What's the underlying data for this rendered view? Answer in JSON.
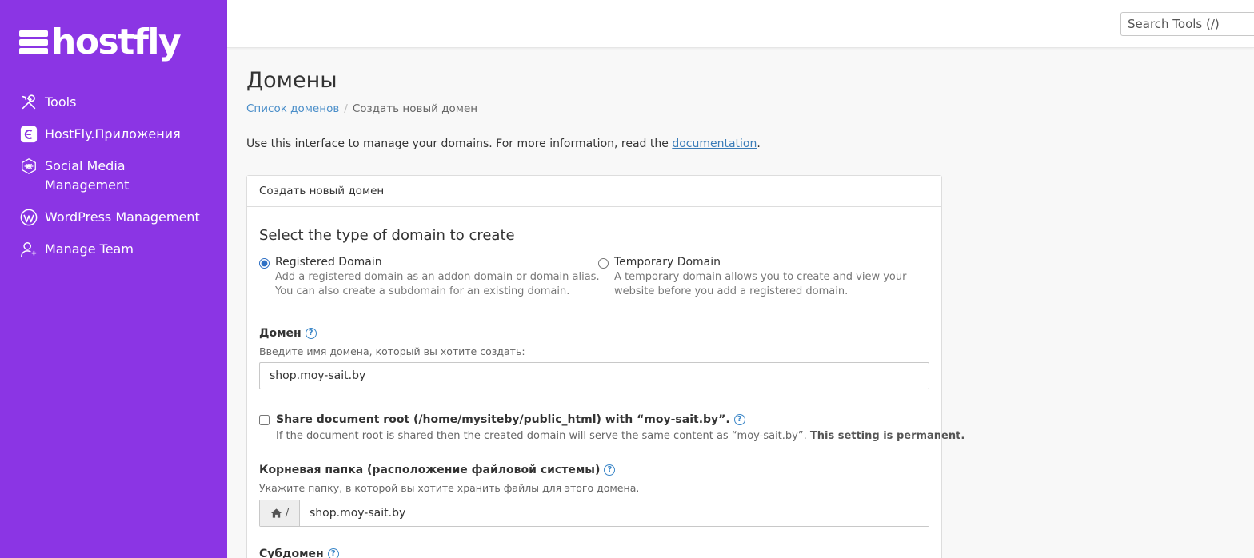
{
  "brand": {
    "name": "hostfly",
    "accent": "#8b35e4",
    "link": "#4a8ec9"
  },
  "sidebar": {
    "items": [
      {
        "label": "Tools",
        "icon": "tools-icon"
      },
      {
        "label": "HostFly.Приложения",
        "icon": "apps-icon"
      },
      {
        "label": "Social Media Management",
        "icon": "social-media-icon"
      },
      {
        "label": "WordPress Management",
        "icon": "wordpress-icon"
      },
      {
        "label": "Manage Team",
        "icon": "manage-team-icon"
      }
    ]
  },
  "topbar": {
    "search_placeholder": "Search Tools (/)"
  },
  "page": {
    "title": "Домены",
    "breadcrumb": {
      "parent": "Список доменов",
      "current": "Создать новый домен"
    },
    "intro_prefix": "Use this interface to manage your domains. For more information, read the ",
    "intro_link": "documentation",
    "intro_suffix": "."
  },
  "panel": {
    "header": "Создать новый домен",
    "section_title": "Select the type of domain to create",
    "registered": {
      "label": "Registered Domain",
      "desc1": "Add a registered domain as an addon domain or domain alias.",
      "desc2": "You can also create a subdomain for an existing domain.",
      "selected": true
    },
    "temporary": {
      "label": "Temporary Domain",
      "desc1": "A temporary domain allows you to create and view your",
      "desc2": "website before you add a registered domain.",
      "selected": false
    },
    "domain": {
      "label": "Домен",
      "hint": "Введите имя домена, который вы хотите создать:",
      "value": "shop.moy-sait.by"
    },
    "share": {
      "label": "Share document root (/home/mysiteby/public_html) with “moy-sait.by”.",
      "desc": "If the document root is shared then the created domain will serve the same content as “moy-sait.by”. ",
      "desc_bold": "This setting is permanent."
    },
    "docroot": {
      "label": "Корневая папка (расположение файловой системы)",
      "hint": "Укажите папку, в которой вы хотите хранить файлы для этого домена.",
      "prefix": "/",
      "value": "shop.moy-sait.by"
    },
    "subdomain": {
      "label": "Субдомен"
    }
  }
}
